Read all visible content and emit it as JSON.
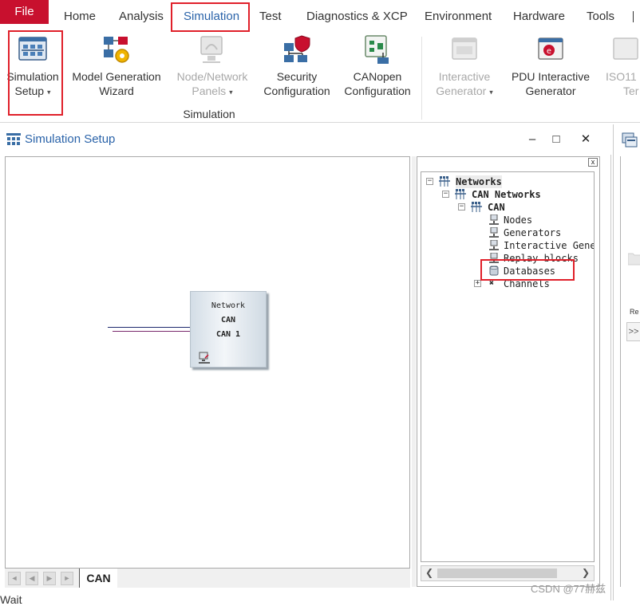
{
  "menubar": {
    "items": [
      "File",
      "Home",
      "Analysis",
      "Simulation",
      "Test",
      "Diagnostics & XCP",
      "Environment",
      "Hardware",
      "Tools"
    ]
  },
  "ribbon": {
    "buttons": [
      {
        "line1": "Simulation",
        "line2": "Setup",
        "caret": "▾"
      },
      {
        "line1": "Model Generation",
        "line2": "Wizard"
      },
      {
        "line1": "Node/Network",
        "line2": "Panels",
        "caret": "▾"
      },
      {
        "line1": "Security",
        "line2": "Configuration"
      },
      {
        "line1": "CANopen",
        "line2": "Configuration"
      },
      {
        "line1": "Interactive",
        "line2": "Generator",
        "caret": "▾"
      },
      {
        "line1": "PDU Interactive",
        "line2": "Generator"
      },
      {
        "line1": "ISO11",
        "line2": "Ter"
      }
    ],
    "group_label": "Simulation"
  },
  "window": {
    "title": "Simulation Setup",
    "controls": {
      "minimize": "–",
      "maximize": "□",
      "close": "✕"
    }
  },
  "network_block": {
    "line1": "Network",
    "line2": "CAN",
    "line3": "CAN 1"
  },
  "tabs": {
    "active": "CAN"
  },
  "tree": {
    "close_glyph": "x",
    "nodes": [
      {
        "label": "Networks",
        "bold": true,
        "pm": "−"
      },
      {
        "label": "CAN Networks",
        "bold": true,
        "pm": "−"
      },
      {
        "label": "CAN",
        "bold": true,
        "pm": "−"
      },
      {
        "label": "Nodes"
      },
      {
        "label": "Generators"
      },
      {
        "label": "Interactive Gener"
      },
      {
        "label": "Replay blocks"
      },
      {
        "label": "Databases"
      },
      {
        "label": "Channels",
        "pm": "+"
      }
    ]
  },
  "right_peek": {
    "label1": "Re",
    "label2": ">>"
  },
  "status": {
    "text": "Wait"
  },
  "watermark": {
    "text": "CSDN @77赫兹"
  },
  "colors": {
    "accent": "#c8102e",
    "highlight_box": "#e0202a",
    "title_blue": "#2a63a9"
  }
}
